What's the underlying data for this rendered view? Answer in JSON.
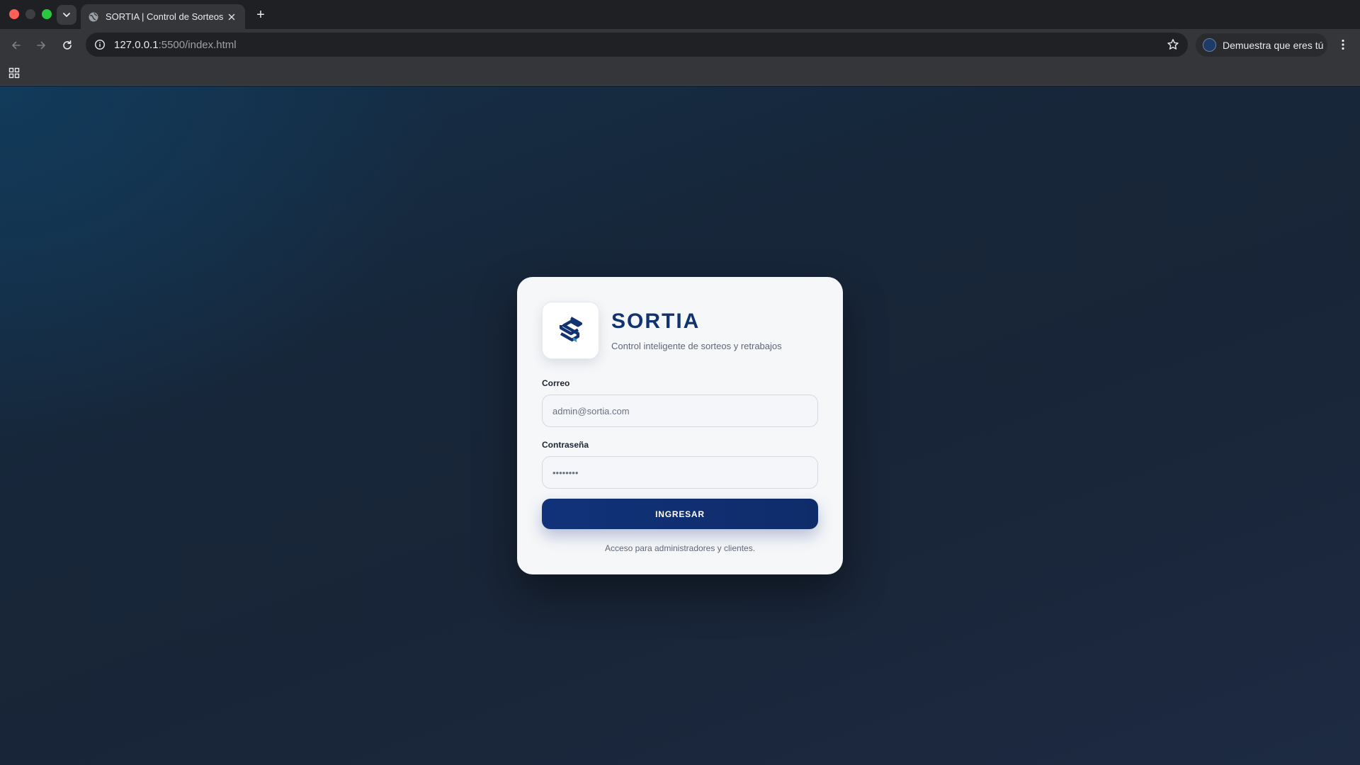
{
  "browser": {
    "tab_title": "SORTIA | Control de Sorteos",
    "new_tab_label": "+",
    "url_host": "127.0.0.1",
    "url_path": ":5500/index.html",
    "profile_label": "Demuestra que eres tú"
  },
  "login": {
    "brand_name": "SORTIA",
    "tagline": "Control inteligente de sorteos y retrabajos",
    "email_label": "Correo",
    "email_placeholder": "admin@sortia.com",
    "password_label": "Contraseña",
    "password_placeholder": "••••••••",
    "submit_label": "INGRESAR",
    "footnote": "Acceso para administradores y clientes."
  },
  "colors": {
    "brand": "#12336f",
    "button": "#11327a",
    "logo_accent": "#1f9ad6",
    "chrome_dark": "#1f2023",
    "chrome_toolbar": "#35363a"
  },
  "icons": [
    "globe-icon",
    "chevron-down-icon",
    "close-icon",
    "back-icon",
    "forward-icon",
    "reload-icon",
    "info-icon",
    "star-icon",
    "apps-icon",
    "more-icon",
    "sortia-logo-icon"
  ]
}
